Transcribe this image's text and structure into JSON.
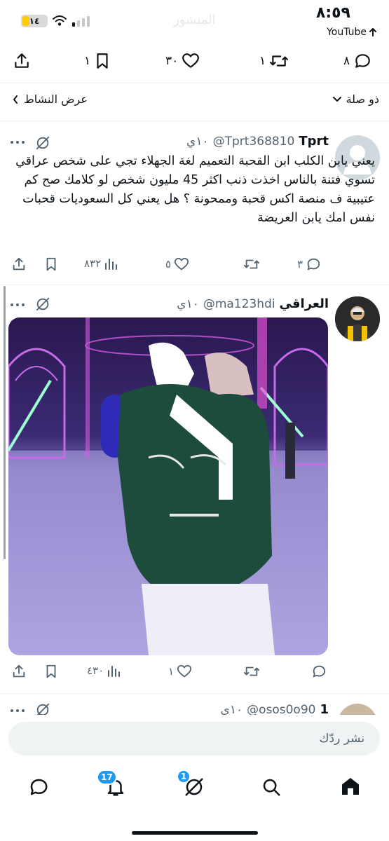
{
  "status_bar": {
    "time": "٨:٥٩",
    "back_app": "YouTube",
    "battery": "١٤"
  },
  "faded_header": "المنشور",
  "top_actions": {
    "reply_count": "٨",
    "retweet_count": "١",
    "like_count": "٣٠",
    "bookmark_count": "١"
  },
  "filter_bar": {
    "sort": "ذو صلة",
    "activity": "عرض النشاط"
  },
  "tweets": [
    {
      "name": "Tprt",
      "handle": "@Tprt368810",
      "time": "١٠ي",
      "text": "يعني يابن الكلب ابن القحبة التعميم لغة الجهلاء تجي على شخص عراقي تسوي فتنة بالناس اخذت ذنب اكثر 45 مليون شخص لو كلامك صح كم عتيبية ف منصة اكس قحبة وممحونة ؟ هل يعني كل السعوديات قحبات نفس امك يابن العريضة",
      "replies": "٣",
      "likes": "٥",
      "views": "٨٣٢"
    },
    {
      "name": "العراقي",
      "handle": "@ma123hdi",
      "time": "١٠ي",
      "replies": "",
      "likes": "١",
      "views": "٤٣٠"
    },
    {
      "name": "1",
      "handle": "@osos0o90",
      "time": "١٠ي"
    }
  ],
  "reply_bar": {
    "placeholder": "نشر ردّك"
  },
  "bottom_nav": {
    "notifications_badge": "17",
    "grok_badge": "1"
  },
  "colors": {
    "accent": "#1d9bf0",
    "text": "#0f1419",
    "secondary": "#536471",
    "divider": "#eff3f4"
  }
}
